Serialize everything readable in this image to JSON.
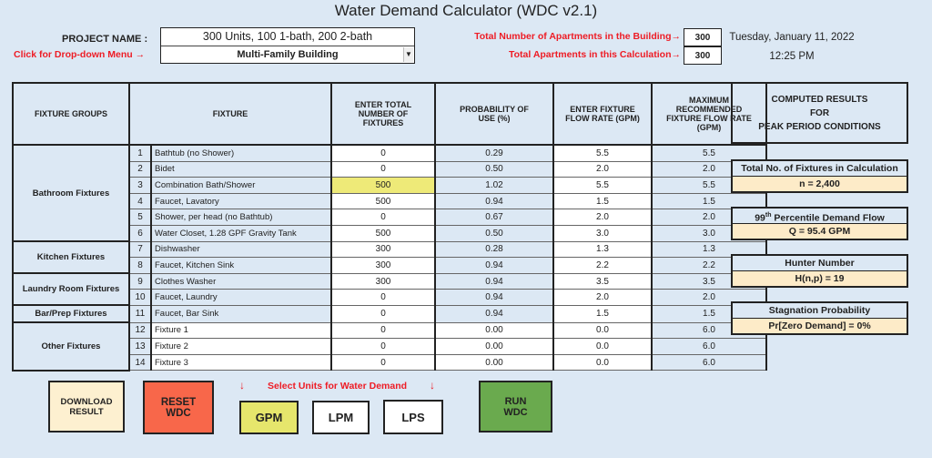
{
  "title": "Water Demand Calculator (WDC v2.1)",
  "project": {
    "label": "PROJECT NAME :",
    "dropdown_hint": "Click for Drop-down Menu →",
    "name": "300 Units, 100 1-bath, 200 2-bath",
    "building_type": "Multi-Family Building"
  },
  "apartments": {
    "total_label": "Total Number of Apartments in the Building→",
    "total_value": "300",
    "calc_label": "Total Apartments in this Calculation→",
    "calc_value": "300"
  },
  "datetime": {
    "date": "Tuesday, January 11, 2022",
    "time": "12:25 PM"
  },
  "table": {
    "headers": {
      "groups": "FIXTURE GROUPS",
      "fixture": "FIXTURE",
      "count": "ENTER TOTAL NUMBER OF FIXTURES",
      "prob": "PROBABILITY OF USE (%)",
      "flow": "ENTER FIXTURE FLOW RATE (GPM)",
      "max": "MAXIMUM RECOMMENDED FIXTURE FLOW RATE (GPM)"
    },
    "groups": [
      "Bathroom Fixtures",
      "Kitchen Fixtures",
      "Laundry Room Fixtures",
      "Bar/Prep Fixtures",
      "Other Fixtures"
    ],
    "rows": [
      {
        "n": "1",
        "fixture": "Bathtub (no Shower)",
        "count": "0",
        "prob": "0.29",
        "flow": "5.5",
        "max": "5.5"
      },
      {
        "n": "2",
        "fixture": "Bidet",
        "count": "0",
        "prob": "0.50",
        "flow": "2.0",
        "max": "2.0"
      },
      {
        "n": "3",
        "fixture": "Combination Bath/Shower",
        "count": "500",
        "prob": "1.02",
        "flow": "5.5",
        "max": "5.5"
      },
      {
        "n": "4",
        "fixture": "Faucet, Lavatory",
        "count": "500",
        "prob": "0.94",
        "flow": "1.5",
        "max": "1.5"
      },
      {
        "n": "5",
        "fixture": "Shower, per head (no Bathtub)",
        "count": "0",
        "prob": "0.67",
        "flow": "2.0",
        "max": "2.0"
      },
      {
        "n": "6",
        "fixture": "Water Closet, 1.28 GPF Gravity Tank",
        "count": "500",
        "prob": "0.50",
        "flow": "3.0",
        "max": "3.0"
      },
      {
        "n": "7",
        "fixture": "Dishwasher",
        "count": "300",
        "prob": "0.28",
        "flow": "1.3",
        "max": "1.3"
      },
      {
        "n": "8",
        "fixture": "Faucet, Kitchen Sink",
        "count": "300",
        "prob": "0.94",
        "flow": "2.2",
        "max": "2.2"
      },
      {
        "n": "9",
        "fixture": "Clothes Washer",
        "count": "300",
        "prob": "0.94",
        "flow": "3.5",
        "max": "3.5"
      },
      {
        "n": "10",
        "fixture": "Faucet, Laundry",
        "count": "0",
        "prob": "0.94",
        "flow": "2.0",
        "max": "2.0"
      },
      {
        "n": "11",
        "fixture": "Faucet, Bar Sink",
        "count": "0",
        "prob": "0.94",
        "flow": "1.5",
        "max": "1.5"
      },
      {
        "n": "12",
        "fixture": "Fixture 1",
        "count": "0",
        "prob": "0.00",
        "flow": "0.0",
        "max": "6.0"
      },
      {
        "n": "13",
        "fixture": "Fixture 2",
        "count": "0",
        "prob": "0.00",
        "flow": "0.0",
        "max": "6.0"
      },
      {
        "n": "14",
        "fixture": "Fixture 3",
        "count": "0",
        "prob": "0.00",
        "flow": "0.0",
        "max": "6.0"
      }
    ]
  },
  "results": {
    "heading_1": "COMPUTED RESULTS",
    "heading_2": "FOR",
    "heading_3": "PEAK PERIOD CONDITIONS",
    "total_fixtures_label": "Total No. of Fixtures in Calculation",
    "total_fixtures_value": "n = 2,400",
    "demand_label_prefix": "99",
    "demand_label_sup": "th",
    "demand_label_suffix": " Percentile Demand Flow",
    "demand_value": "Q = 95.4 GPM",
    "hunter_label": "Hunter Number",
    "hunter_value": "H(n,p) = 19",
    "stagnation_label": "Stagnation Probability",
    "stagnation_value": "Pr[Zero Demand] = 0%"
  },
  "buttons": {
    "download_1": "DOWNLOAD",
    "download_2": "RESULT",
    "reset_1": "RESET",
    "reset_2": "WDC",
    "run_1": "RUN",
    "run_2": "WDC",
    "units_hint": "Select Units for Water Demand",
    "arrow": "↓",
    "gpm": "GPM",
    "lpm": "LPM",
    "lps": "LPS",
    "selected_unit": "GPM"
  },
  "colors": {
    "background": "#dce8f4",
    "highlight_yellow": "#eeea78",
    "result_value_bg": "#fdebc8",
    "download_bg": "#fdf0d0",
    "reset_bg": "#f8674a",
    "run_bg": "#6aaa4e",
    "gpm_selected_bg": "#e6e66c",
    "red_text": "#ee1c25"
  }
}
